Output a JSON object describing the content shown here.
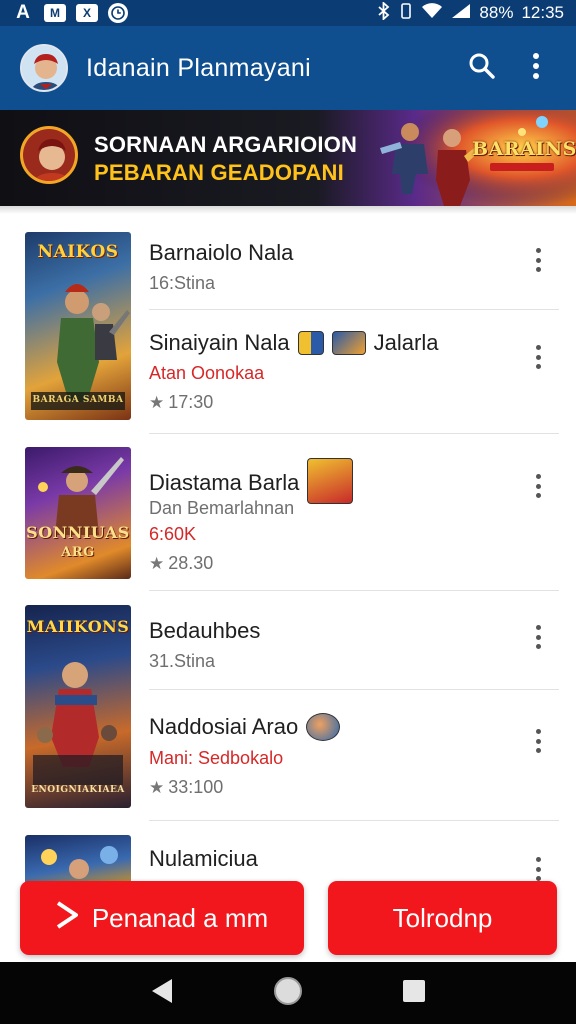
{
  "status_bar": {
    "left_icons": [
      "A",
      "M",
      "X",
      "clock"
    ],
    "battery_percent": "88%",
    "time": "12:35"
  },
  "app_bar": {
    "title": "Idanain Planmayani",
    "search_icon": "search-icon",
    "menu_icon": "more-vert-icon"
  },
  "banner": {
    "line1": "SORNAAN ARGARIOION",
    "line2": "PEBARAN GEADOPANI",
    "logo_text": "BARAINS",
    "line1_color": "#ffffff",
    "line2_color": "#ffc21a"
  },
  "list": {
    "items": [
      {
        "thumb_label": "NAIKOS",
        "thumb_caption": "BARAGA SAMBA",
        "title": "Barnaiolo Nala",
        "subtitle": "16:Stina",
        "subtitle_red": false,
        "rating": ""
      },
      {
        "thumb_label": "",
        "title": "Sinaiyain Nala",
        "title_suffix": "Jalarla",
        "subtitle": "Atan Oonokaa",
        "subtitle_red": true,
        "rating": "17:30"
      },
      {
        "thumb_label": "SONNIUAS",
        "thumb_caption": "ARG",
        "title": "Diastama Barla",
        "subtitle": "Dan Bemarlahnan",
        "extra_line": "6:60K",
        "subtitle_red": false,
        "rating": "28.30"
      },
      {
        "thumb_label": "MAIIKONS",
        "thumb_caption": "ENOIGNIAKIAEA",
        "title": "Bedauhbes",
        "subtitle": "31.Stina",
        "subtitle_red": false,
        "rating": ""
      },
      {
        "thumb_label": "",
        "title": "Naddosiai Arao",
        "subtitle": "Mani: Sedbokalo",
        "subtitle_red": true,
        "rating": "33:100"
      },
      {
        "thumb_label": "",
        "title": "Nulamiciua",
        "subtitle": "",
        "subtitle_red": false,
        "rating": ""
      }
    ]
  },
  "actions": {
    "primary_label": "Penanad a mm",
    "secondary_label": "Tolrodnp",
    "button_color": "#f2171c"
  },
  "nav": {
    "back_icon": "back-triangle-icon",
    "home_icon": "home-circle-icon",
    "recents_icon": "recents-square-icon"
  }
}
